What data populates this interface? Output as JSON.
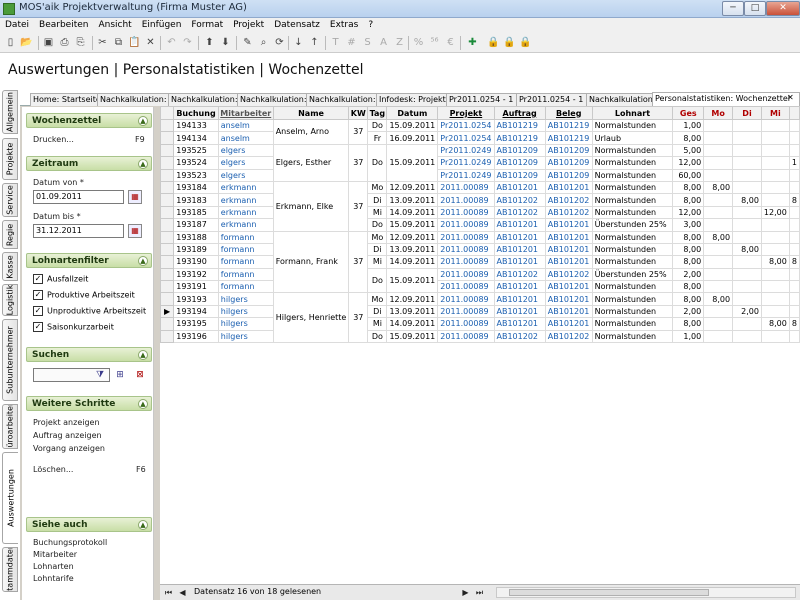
{
  "window": {
    "title": "MOS'aik Projektverwaltung (Firma Muster AG)",
    "min": "─",
    "max": "□",
    "close": "✕"
  },
  "menu": [
    "Datei",
    "Bearbeiten",
    "Ansicht",
    "Einfügen",
    "Format",
    "Projekt",
    "Datensatz",
    "Extras",
    "?"
  ],
  "toolbar": {
    "icons": [
      "new-icon",
      "open-icon",
      "save-icon",
      "print-icon",
      "print-preview-icon",
      "cut-icon",
      "copy-icon",
      "paste-icon",
      "delete-icon",
      "undo-icon",
      "redo-icon",
      "up-icon",
      "down-icon",
      "edit-icon",
      "search-icon",
      "refresh-icon",
      "sort-asc-icon",
      "sort-desc-icon",
      "t-icon",
      "hash-icon",
      "s-icon",
      "a-icon",
      "z-icon",
      "percent-icon",
      "decimal-icon",
      "currency-icon",
      "tools-icon",
      "lock-blue-icon",
      "lock-yellow-icon",
      "lock-red-icon"
    ],
    "glyphs": [
      "▯",
      "📂",
      "▣",
      "⎙",
      "⎘",
      "✂",
      "⧉",
      "📋",
      "✕",
      "↶",
      "↷",
      "⬆",
      "⬇",
      "✎",
      "⌕",
      "⟳",
      "↓",
      "↑",
      "T",
      "#",
      "S",
      "A",
      "Z",
      "%",
      "⁵⁶",
      "€",
      "✚",
      "🔒",
      "🔒",
      "🔒"
    ]
  },
  "page_title": "Auswertungen | Personalstatistiken | Wochenzettel",
  "side_tabs": [
    "Allgemein",
    "Projekte",
    "Service",
    "Regie",
    "Kasse",
    "Logistik",
    "Subunternehmer",
    "Büroarbeiten",
    "Auswertungen",
    "Stammdaten"
  ],
  "doc_tabs": [
    "Home: Startseite",
    "Nachkalkulation:",
    "Nachkalkulation:",
    "Nachkalkulation:",
    "Nachkalkulation:",
    "Infodesk: Projekt",
    "Pr2011.0254 - 1",
    "Pr2011.0254 - 1",
    "Nachkalkulation:",
    "Personalstatistiken: Wochenzettel"
  ],
  "left": {
    "wochenzettel": {
      "title": "Wochenzettel",
      "action": "Drucken...",
      "key": "F9"
    },
    "zeitraum": {
      "title": "Zeitraum",
      "von_label": "Datum von *",
      "von": "01.09.2011",
      "bis_label": "Datum bis *",
      "bis": "31.12.2011"
    },
    "lohnarten": {
      "title": "Lohnartenfilter",
      "items": [
        "Ausfallzeit",
        "Produktive Arbeitszeit",
        "Unproduktive Arbeitszeit",
        "Saisonkurzarbeit"
      ]
    },
    "suchen": {
      "title": "Suchen"
    },
    "weitere": {
      "title": "Weitere Schritte",
      "items": [
        "Projekt anzeigen",
        "Auftrag anzeigen",
        "Vorgang anzeigen"
      ],
      "loeschen": "Löschen...",
      "loeschen_key": "F6"
    },
    "siehe": {
      "title": "Siehe auch",
      "items": [
        "Buchungsprotokoll",
        "Mitarbeiter",
        "Lohnarten",
        "Lohntarife"
      ]
    }
  },
  "grid": {
    "headers": [
      "Buchung",
      "Mitarbeiter",
      "Name",
      "KW",
      "Tag",
      "Datum",
      "Projekt",
      "Auftrag",
      "Beleg",
      "Lohnart",
      "Ges",
      "Mo",
      "Di",
      "Mi",
      ""
    ],
    "rows": [
      {
        "b": "194133",
        "m": "anselm",
        "tag": "Do",
        "datum": "15.09.2011",
        "p": "Pr2011.0254",
        "a": "AB101219",
        "be": "AB101219",
        "l": "Normalstunden",
        "ges": "1,00",
        "mo": "",
        "di": "",
        "mi": ""
      },
      {
        "b": "194134",
        "m": "anselm",
        "tag": "Fr",
        "datum": "16.09.2011",
        "p": "Pr2011.0254",
        "a": "AB101219",
        "be": "AB101219",
        "l": "Urlaub",
        "ges": "8,00",
        "mo": "",
        "di": "",
        "mi": ""
      },
      {
        "b": "193525",
        "m": "elgers",
        "tag": "",
        "datum": "",
        "p": "Pr2011.0249",
        "a": "AB101209",
        "be": "AB101209",
        "l": "Normalstunden",
        "ges": "5,00",
        "mo": "",
        "di": "",
        "mi": ""
      },
      {
        "b": "193524",
        "m": "elgers",
        "tag": "Do",
        "datum": "15.09.2011",
        "p": "Pr2011.0249",
        "a": "AB101209",
        "be": "AB101209",
        "l": "Normalstunden",
        "ges": "12,00",
        "mo": "",
        "di": "",
        "mi": ""
      },
      {
        "b": "193523",
        "m": "elgers",
        "tag": "",
        "datum": "",
        "p": "Pr2011.0249",
        "a": "AB101209",
        "be": "AB101209",
        "l": "Normalstunden",
        "ges": "60,00",
        "mo": "",
        "di": "",
        "mi": ""
      },
      {
        "b": "193184",
        "m": "erkmann",
        "tag": "Mo",
        "datum": "12.09.2011",
        "p": "2011.00089",
        "a": "AB101201",
        "be": "AB101201",
        "l": "Normalstunden",
        "ges": "8,00",
        "mo": "8,00",
        "di": "",
        "mi": ""
      },
      {
        "b": "193183",
        "m": "erkmann",
        "tag": "Di",
        "datum": "13.09.2011",
        "p": "2011.00089",
        "a": "AB101202",
        "be": "AB101202",
        "l": "Normalstunden",
        "ges": "8,00",
        "mo": "",
        "di": "8,00",
        "mi": ""
      },
      {
        "b": "193185",
        "m": "erkmann",
        "tag": "Mi",
        "datum": "14.09.2011",
        "p": "2011.00089",
        "a": "AB101202",
        "be": "AB101202",
        "l": "Normalstunden",
        "ges": "12,00",
        "mo": "",
        "di": "",
        "mi": "12,00"
      },
      {
        "b": "193187",
        "m": "erkmann",
        "tag": "Do",
        "datum": "15.09.2011",
        "p": "2011.00089",
        "a": "AB101201",
        "be": "AB101201",
        "l": "Überstunden 25%",
        "ges": "3,00",
        "mo": "",
        "di": "",
        "mi": ""
      },
      {
        "b": "193188",
        "m": "formann",
        "tag": "Mo",
        "datum": "12.09.2011",
        "p": "2011.00089",
        "a": "AB101201",
        "be": "AB101201",
        "l": "Normalstunden",
        "ges": "8,00",
        "mo": "8,00",
        "di": "",
        "mi": ""
      },
      {
        "b": "193189",
        "m": "formann",
        "tag": "Di",
        "datum": "13.09.2011",
        "p": "2011.00089",
        "a": "AB101201",
        "be": "AB101201",
        "l": "Normalstunden",
        "ges": "8,00",
        "mo": "",
        "di": "8,00",
        "mi": ""
      },
      {
        "b": "193190",
        "m": "formann",
        "tag": "Mi",
        "datum": "14.09.2011",
        "p": "2011.00089",
        "a": "AB101201",
        "be": "AB101201",
        "l": "Normalstunden",
        "ges": "8,00",
        "mo": "",
        "di": "",
        "mi": "8,00"
      },
      {
        "b": "193192",
        "m": "formann",
        "tag": "",
        "datum": "",
        "p": "2011.00089",
        "a": "AB101202",
        "be": "AB101202",
        "l": "Überstunden 25%",
        "ges": "2,00",
        "mo": "",
        "di": "",
        "mi": ""
      },
      {
        "b": "193191",
        "m": "formann",
        "tag": "",
        "datum": "",
        "p": "2011.00089",
        "a": "AB101201",
        "be": "AB101201",
        "l": "Normalstunden",
        "ges": "8,00",
        "mo": "",
        "di": "",
        "mi": ""
      },
      {
        "b": "193193",
        "m": "hilgers",
        "tag": "Mo",
        "datum": "12.09.2011",
        "p": "2011.00089",
        "a": "AB101201",
        "be": "AB101201",
        "l": "Normalstunden",
        "ges": "8,00",
        "mo": "8,00",
        "di": "",
        "mi": ""
      },
      {
        "b": "193194",
        "m": "hilgers",
        "tag": "Di",
        "datum": "13.09.2011",
        "p": "2011.00089",
        "a": "AB101201",
        "be": "AB101201",
        "l": "Normalstunden",
        "ges": "2,00",
        "mo": "",
        "di": "2,00",
        "mi": ""
      },
      {
        "b": "193195",
        "m": "hilgers",
        "tag": "Mi",
        "datum": "14.09.2011",
        "p": "2011.00089",
        "a": "AB101201",
        "be": "AB101201",
        "l": "Normalstunden",
        "ges": "8,00",
        "mo": "",
        "di": "",
        "mi": "8,00"
      },
      {
        "b": "193196",
        "m": "hilgers",
        "tag": "",
        "datum": "15.09.2011",
        "p": "2011.00089",
        "a": "AB101202",
        "be": "AB101202",
        "l": "Normalstunden",
        "ges": "1,00",
        "mo": "",
        "di": "",
        "mi": ""
      }
    ],
    "groups": [
      {
        "start": 0,
        "span": 2,
        "name": "Anselm, Arno",
        "kw": "37"
      },
      {
        "start": 2,
        "span": 3,
        "name": "Elgers, Esther",
        "kw": "37",
        "tag": "Do",
        "datum": "15.09.2011"
      },
      {
        "start": 5,
        "span": 4,
        "name": "Erkmann, Elke",
        "kw": "37"
      },
      {
        "start": 9,
        "span": 5,
        "name": "Formann, Frank",
        "kw": "37",
        "tag": "Do",
        "datum": "15.09.2011"
      },
      {
        "start": 14,
        "span": 4,
        "name": "Hilgers, Henriette",
        "kw": "37",
        "tag": "Do"
      }
    ],
    "current_row": 15,
    "extra_right": {
      "3": "1",
      "6": "8",
      "11": "8",
      "15": "",
      "16": "8"
    }
  },
  "status": {
    "text": "Datensatz 16 von 18 gelesenen"
  }
}
